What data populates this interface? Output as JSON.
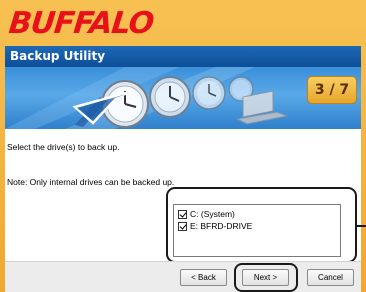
{
  "brand": {
    "logo_text": "BUFFALO"
  },
  "window": {
    "title": "Backup Utility"
  },
  "wizard": {
    "step_label": "3 / 7",
    "current_step": 3,
    "total_steps": 7
  },
  "content": {
    "instruction": "Select the drive(s) to back up.",
    "note": "Note: Only internal drives can be backed up.",
    "drives": [
      {
        "label": "C: (System)",
        "checked": true
      },
      {
        "label": "E: BFRD-DRIVE",
        "checked": true
      }
    ]
  },
  "buttons": {
    "back": "< Back",
    "next": "Next >",
    "cancel": "Cancel"
  },
  "colors": {
    "frame": "#f0a830",
    "brand": "#e8101a",
    "titlebar": "#0d4e98",
    "banner": "#3a8fd8",
    "badge": "#e8a52b"
  }
}
